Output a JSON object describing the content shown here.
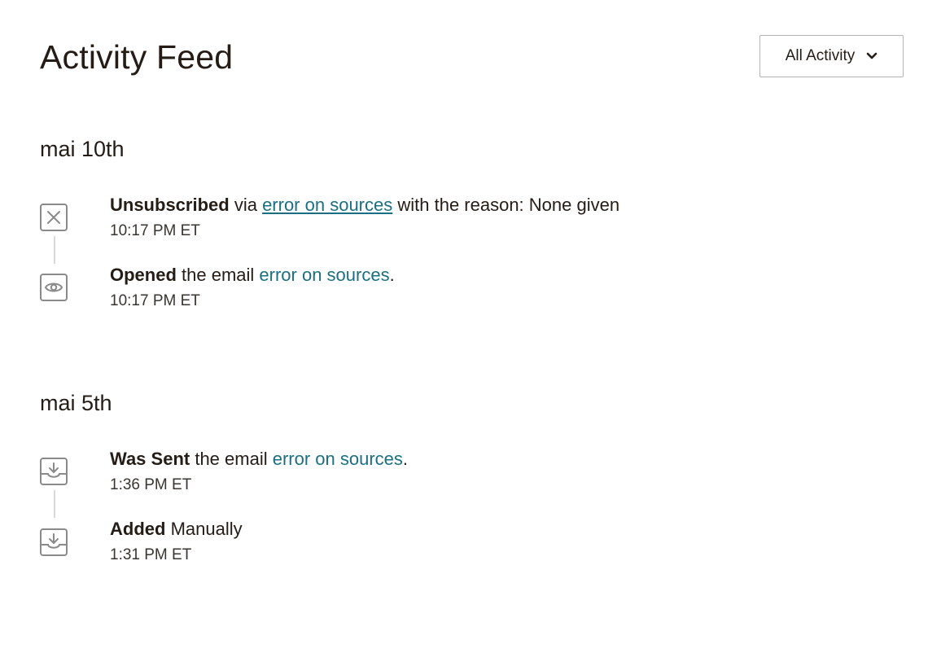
{
  "header": {
    "title": "Activity Feed",
    "filter_label": "All Activity"
  },
  "groups": [
    {
      "date": "mai 10th",
      "events": [
        {
          "icon": "unsubscribe-x-icon",
          "action": "Unsubscribed",
          "pre": " via ",
          "link": "error on sources",
          "post": " with the reason: None given",
          "time": "10:17 PM ET"
        },
        {
          "icon": "eye-icon",
          "action": "Opened",
          "pre": " the email ",
          "link": "error on sources",
          "post": ".",
          "time": "10:17 PM ET"
        }
      ]
    },
    {
      "date": "mai 5th",
      "events": [
        {
          "icon": "inbox-download-icon",
          "action": "Was Sent",
          "pre": " the email ",
          "link": "error on sources",
          "post": ".",
          "time": "1:36 PM ET"
        },
        {
          "icon": "inbox-download-icon",
          "action": "Added",
          "pre": " Manually",
          "time": "1:31 PM ET"
        }
      ]
    }
  ],
  "colors": {
    "link": "#1b6f83",
    "icon_stroke": "#8a8a8a",
    "text": "#241c15"
  }
}
